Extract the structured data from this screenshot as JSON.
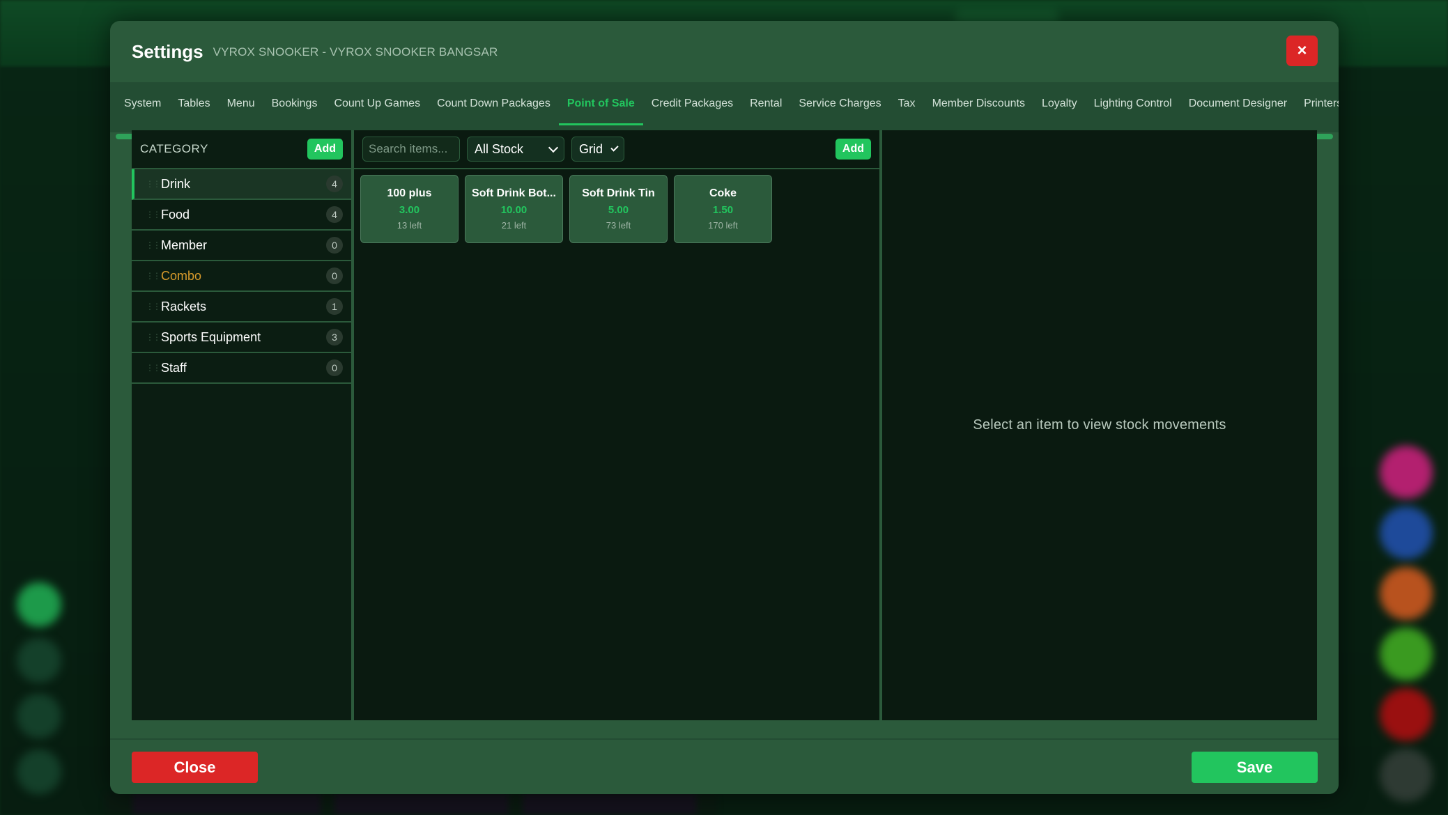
{
  "modal": {
    "title": "Settings",
    "subtitle": "VYROX SNOOKER - VYROX SNOOKER BANGSAR",
    "close_x": "×"
  },
  "tabs": [
    {
      "label": "System"
    },
    {
      "label": "Tables"
    },
    {
      "label": "Menu"
    },
    {
      "label": "Bookings"
    },
    {
      "label": "Count Up Games"
    },
    {
      "label": "Count Down Packages"
    },
    {
      "label": "Point of Sale",
      "active": true
    },
    {
      "label": "Credit Packages"
    },
    {
      "label": "Rental"
    },
    {
      "label": "Service Charges"
    },
    {
      "label": "Tax"
    },
    {
      "label": "Member Discounts"
    },
    {
      "label": "Loyalty"
    },
    {
      "label": "Lighting Control"
    },
    {
      "label": "Document Designer"
    },
    {
      "label": "Printers"
    }
  ],
  "category": {
    "title": "CATEGORY",
    "add_label": "Add",
    "items": [
      {
        "label": "Drink",
        "count": "4"
      },
      {
        "label": "Food",
        "count": "4"
      },
      {
        "label": "Member",
        "count": "0"
      },
      {
        "label": "Combo",
        "count": "0"
      },
      {
        "label": "Rackets",
        "count": "1"
      },
      {
        "label": "Sports Equipment",
        "count": "3"
      },
      {
        "label": "Staff",
        "count": "0"
      }
    ]
  },
  "items_toolbar": {
    "search_placeholder": "Search items...",
    "stock_filter": "All Stock",
    "view_mode": "Grid",
    "add_label": "Add"
  },
  "items": [
    {
      "name": "100 plus",
      "price": "3.00",
      "stock": "13 left"
    },
    {
      "name": "Soft Drink Bot...",
      "price": "10.00",
      "stock": "21 left"
    },
    {
      "name": "Soft Drink Tin",
      "price": "5.00",
      "stock": "73 left"
    },
    {
      "name": "Coke",
      "price": "1.50",
      "stock": "170 left"
    }
  ],
  "movements": {
    "empty_text": "Select an item to view stock movements"
  },
  "footer": {
    "close_label": "Close",
    "save_label": "Save"
  },
  "colors": {
    "accent": "#22c55e",
    "danger": "#dc2626",
    "modal_bg": "#2b5a3b",
    "highlight_category": "#d99b2b"
  }
}
